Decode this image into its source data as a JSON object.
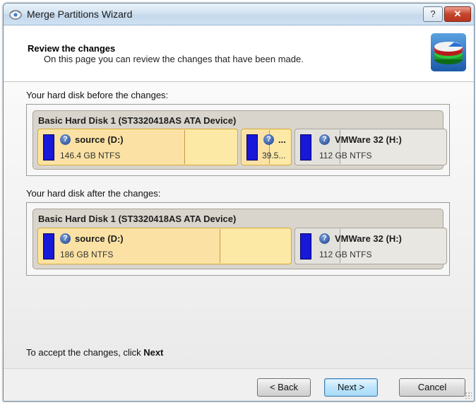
{
  "window": {
    "title": "Merge Partitions Wizard",
    "help_label": "?",
    "close_label": "✕"
  },
  "header": {
    "title": "Review the changes",
    "subtitle": "On this page you can review the changes that have been made."
  },
  "before": {
    "label": "Your hard disk before the changes:",
    "disk_title": "Basic Hard Disk 1 (ST3320418AS ATA Device)",
    "partitions": [
      {
        "name": "source (D:)",
        "size": "146.4 GB NTFS",
        "used_fraction": 0.72
      },
      {
        "name": "...",
        "size": "39.5...",
        "used_fraction": 0.55
      },
      {
        "name": "VMWare 32 (H:)",
        "size": "112 GB NTFS",
        "used_fraction": 0.3
      }
    ]
  },
  "after": {
    "label": "Your hard disk after the changes:",
    "disk_title": "Basic Hard Disk 1 (ST3320418AS ATA Device)",
    "partitions": [
      {
        "name": "source (D:)",
        "size": "186 GB NTFS",
        "used_fraction": 0.71
      },
      {
        "name": "VMWare 32 (H:)",
        "size": "112 GB NTFS",
        "used_fraction": 0.3
      }
    ]
  },
  "footer": {
    "accept_text": "To accept the changes, click ",
    "accept_bold": "Next",
    "back_label": "< Back",
    "next_label": "Next >",
    "cancel_label": "Cancel"
  },
  "colors": {
    "selected_partition": "#fde9a6",
    "partition_bar": "#1818d8",
    "disk_panel": "#d9d5cc"
  }
}
